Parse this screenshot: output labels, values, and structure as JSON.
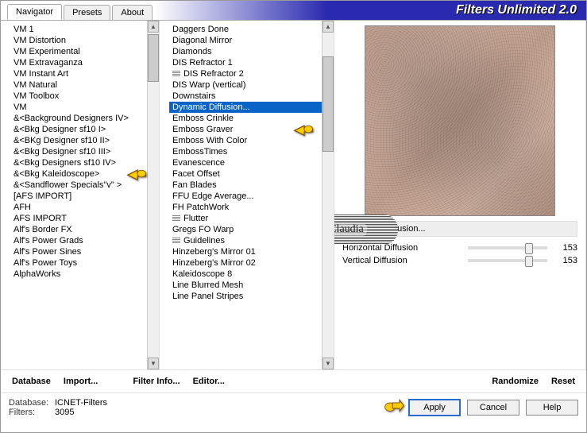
{
  "header": {
    "tabs": [
      "Navigator",
      "Presets",
      "About"
    ],
    "active_tab_index": 0,
    "title": "Filters Unlimited 2.0"
  },
  "categories": [
    "VM 1",
    "VM Distortion",
    "VM Experimental",
    "VM Extravaganza",
    "VM Instant Art",
    "VM Natural",
    "VM Toolbox",
    "VM",
    "&<Background Designers IV>",
    "&<Bkg Designer sf10 I>",
    "&<BKg Designer sf10 II>",
    "&<Bkg Designer sf10 III>",
    "&<Bkg Designers sf10 IV>",
    "&<Bkg Kaleidoscope>",
    "&<Sandflower Specials\"v\" >",
    "[AFS IMPORT]",
    "AFH",
    "AFS IMPORT",
    "Alf's Border FX",
    "Alf's Power Grads",
    "Alf's Power Sines",
    "Alf's Power Toys",
    "AlphaWorks"
  ],
  "selected_category_index": 10,
  "filters": [
    {
      "icon": false,
      "label": "Daggers Done"
    },
    {
      "icon": false,
      "label": "Diagonal Mirror"
    },
    {
      "icon": false,
      "label": "Diamonds"
    },
    {
      "icon": false,
      "label": "DIS Refractor 1"
    },
    {
      "icon": true,
      "label": "DIS Refractor 2"
    },
    {
      "icon": false,
      "label": "DIS Warp (vertical)"
    },
    {
      "icon": false,
      "label": "Downstairs"
    },
    {
      "icon": false,
      "label": "Dynamic Diffusion..."
    },
    {
      "icon": false,
      "label": "Emboss Crinkle"
    },
    {
      "icon": false,
      "label": "Emboss Graver"
    },
    {
      "icon": false,
      "label": "Emboss With Color"
    },
    {
      "icon": false,
      "label": "EmbossTimes"
    },
    {
      "icon": false,
      "label": "Evanescence"
    },
    {
      "icon": false,
      "label": "Facet Offset"
    },
    {
      "icon": false,
      "label": "Fan Blades"
    },
    {
      "icon": false,
      "label": "FFU Edge Average..."
    },
    {
      "icon": false,
      "label": "FH PatchWork"
    },
    {
      "icon": true,
      "label": "Flutter"
    },
    {
      "icon": false,
      "label": "Gregs FO Warp"
    },
    {
      "icon": true,
      "label": "Guidelines"
    },
    {
      "icon": false,
      "label": "Hinzeberg's Mirror 01"
    },
    {
      "icon": false,
      "label": "Hinzeberg's Mirror 02"
    },
    {
      "icon": false,
      "label": "Kaleidoscope 8"
    },
    {
      "icon": false,
      "label": "Line Blurred Mesh"
    },
    {
      "icon": false,
      "label": "Line Panel Stripes"
    }
  ],
  "selected_filter_index": 7,
  "right": {
    "selected_filter_name": "Dynamic Diffusion...",
    "params": [
      {
        "label": "Horizontal Diffusion",
        "value": 153
      },
      {
        "label": "Vertical Diffusion",
        "value": 153
      }
    ]
  },
  "button_row": {
    "database": "Database",
    "import": "Import...",
    "filter_info": "Filter Info...",
    "editor": "Editor...",
    "randomize": "Randomize",
    "reset": "Reset"
  },
  "footer": {
    "db_label": "Database:",
    "db_value": "ICNET-Filters",
    "filters_label": "Filters:",
    "filters_value": "3095",
    "apply": "Apply",
    "cancel": "Cancel",
    "help": "Help"
  },
  "watermark": "Claudia"
}
